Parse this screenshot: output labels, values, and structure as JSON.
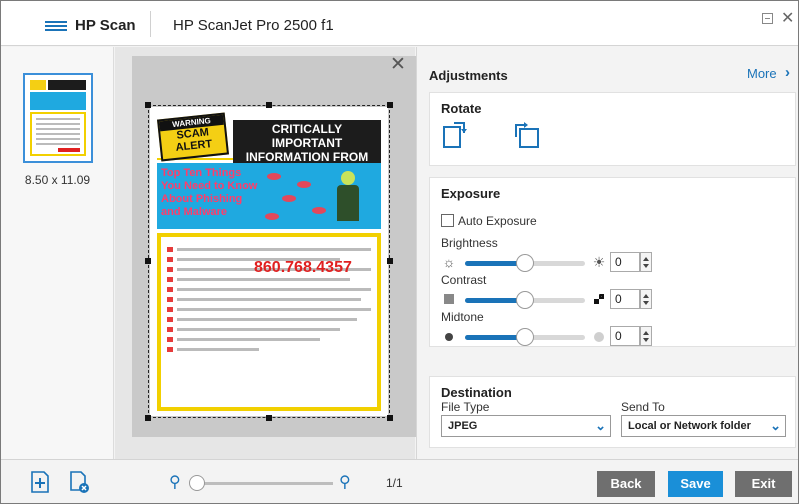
{
  "titlebar": {
    "app_name": "HP Scan",
    "device_name": "HP ScanJet Pro 2500 f1"
  },
  "thumbnail": {
    "size_label": "8.50 x 11.09"
  },
  "document": {
    "warning_top": "WARNING",
    "scam_alert": "SCAM ALERT",
    "title": "CRITICALLY IMPORTANT INFORMATION FROM OTS",
    "banner_text": "Top Ten Things You Need to Know About Phishing and Malware",
    "phone": "860.768.4357"
  },
  "panel": {
    "title": "Adjustments",
    "more_label": "More",
    "rotate": {
      "title": "Rotate"
    },
    "exposure": {
      "title": "Exposure",
      "auto_exposure_label": "Auto Exposure",
      "auto_exposure_checked": false,
      "brightness": {
        "label": "Brightness",
        "value": "0",
        "level": 0.5
      },
      "contrast": {
        "label": "Contrast",
        "value": "0",
        "level": 0.5
      },
      "midtone": {
        "label": "Midtone",
        "value": "0",
        "level": 0.5
      }
    },
    "destination": {
      "title": "Destination",
      "file_type_label": "File Type",
      "file_type_value": "JPEG",
      "send_to_label": "Send To",
      "send_to_value": "Local or Network folder"
    }
  },
  "bottombar": {
    "page_count": "1/1",
    "zoom_level": 0,
    "back_label": "Back",
    "save_label": "Save",
    "exit_label": "Exit"
  },
  "colors": {
    "accent": "#1a73b8",
    "save_button": "#1a8fd8",
    "secondary_button": "#6f6f6f"
  }
}
